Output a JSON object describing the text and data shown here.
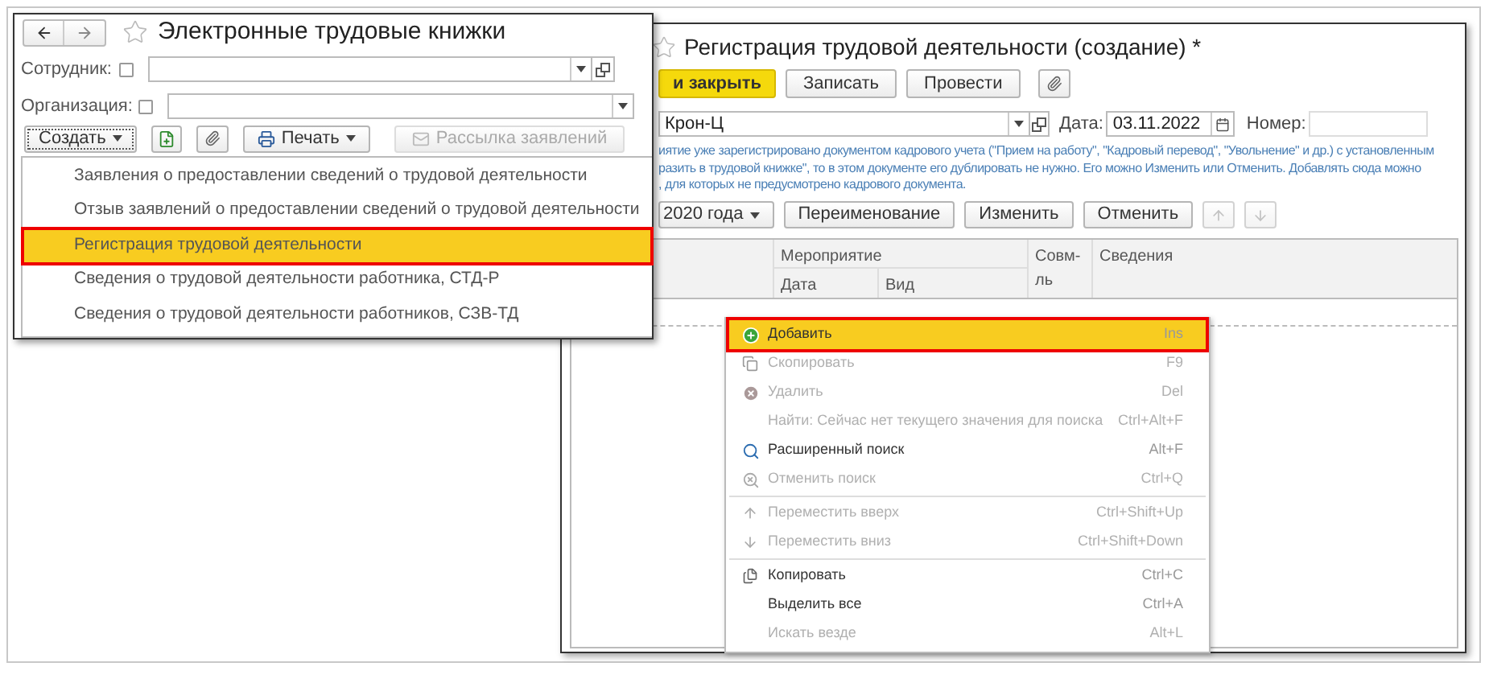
{
  "left_window": {
    "title": "Электронные трудовые книжки",
    "filters": [
      {
        "label": "Сотрудник:",
        "checked": false,
        "open_button": true
      },
      {
        "label": "Организация:",
        "checked": false,
        "open_button": false
      }
    ],
    "toolbar": {
      "create": "Создать",
      "print": "Печать",
      "mailing": {
        "label": "Рассылка заявлений",
        "disabled": true
      }
    },
    "create_menu": [
      {
        "label": "Заявления о предоставлении сведений о трудовой деятельности",
        "selected": false,
        "highlighted": false
      },
      {
        "label": "Отзыв заявлений о предоставлении сведений о трудовой деятельности",
        "selected": false,
        "highlighted": false
      },
      {
        "label": "Регистрация трудовой деятельности",
        "selected": true,
        "highlighted": true
      },
      {
        "label": "Сведения о трудовой деятельности работника, СТД-Р",
        "selected": false,
        "highlighted": false
      },
      {
        "label": "Сведения о трудовой деятельности работников, СЗВ-ТД",
        "selected": false,
        "highlighted": false
      }
    ]
  },
  "right_window": {
    "title": "Регистрация трудовой деятельности (создание) *",
    "buttons": [
      {
        "label": "и закрыть",
        "kind": "primary"
      },
      {
        "label": "Записать",
        "kind": "default"
      },
      {
        "label": "Провести",
        "kind": "default"
      }
    ],
    "organization": "Крон-Ц",
    "date_label": "Дата:",
    "date": "03.11.2022",
    "number_label": "Номер:",
    "info_lines": [
      "иятие уже зарегистрировано документом кадрового учета (\"Прием на работу\", \"Кадровый перевод\", \"Увольнение\" и др.) с установленным",
      "разить в трудовой книжке\", то в этом документе его дублировать не нужно. Его можно Изменить или Отменить. Добавлять сюда можно",
      ", для которых не предусмотрено кадрового документа."
    ],
    "period": "2020 года",
    "table_buttons": [
      "Переименование",
      "Изменить",
      "Отменить"
    ],
    "columns": [
      {
        "label": "Мероприятие",
        "children": [
          "Дата",
          "Вид"
        ]
      },
      {
        "label": "Совм-ль"
      },
      {
        "label": "Сведения"
      }
    ]
  },
  "context_menu": {
    "groups": [
      [
        {
          "label": "Добавить",
          "shortcut": "Ins",
          "disabled": false,
          "selected": true,
          "highlighted": true
        },
        {
          "label": "Скопировать",
          "shortcut": "F9",
          "disabled": true,
          "selected": false,
          "highlighted": false
        },
        {
          "label": "Удалить",
          "shortcut": "Del",
          "disabled": true,
          "selected": false,
          "highlighted": false
        },
        {
          "label": "Найти: Сейчас нет текущего значения для поиска",
          "shortcut": "Ctrl+Alt+F",
          "disabled": true,
          "selected": false,
          "highlighted": false
        },
        {
          "label": "Расширенный поиск",
          "shortcut": "Alt+F",
          "disabled": false,
          "selected": false,
          "highlighted": false
        },
        {
          "label": "Отменить поиск",
          "shortcut": "Ctrl+Q",
          "disabled": true,
          "selected": false,
          "highlighted": false
        }
      ],
      [
        {
          "label": "Переместить вверх",
          "shortcut": "Ctrl+Shift+Up",
          "disabled": true,
          "selected": false,
          "highlighted": false
        },
        {
          "label": "Переместить вниз",
          "shortcut": "Ctrl+Shift+Down",
          "disabled": true,
          "selected": false,
          "highlighted": false
        }
      ],
      [
        {
          "label": "Копировать",
          "shortcut": "Ctrl+C",
          "disabled": false,
          "selected": false,
          "highlighted": false
        },
        {
          "label": "Выделить все",
          "shortcut": "Ctrl+A",
          "disabled": false,
          "selected": false,
          "highlighted": false
        },
        {
          "label": "Искать везде",
          "shortcut": "Alt+L",
          "disabled": true,
          "selected": false,
          "highlighted": false
        }
      ]
    ]
  }
}
